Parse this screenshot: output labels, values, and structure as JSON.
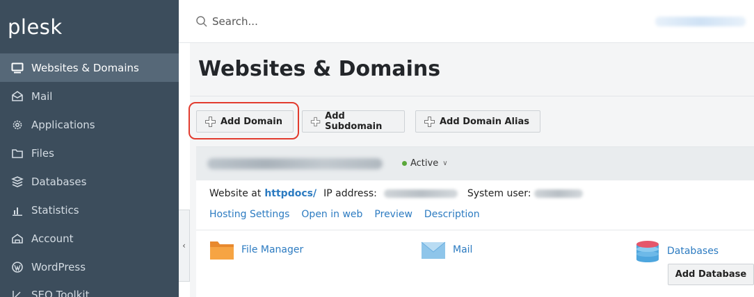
{
  "sidebar": {
    "logo": "plesk",
    "items": [
      {
        "label": "Websites & Domains",
        "icon": "monitor-icon",
        "active": true
      },
      {
        "label": "Mail",
        "icon": "mail-icon",
        "active": false
      },
      {
        "label": "Applications",
        "icon": "gear-icon",
        "active": false
      },
      {
        "label": "Files",
        "icon": "folder-icon",
        "active": false
      },
      {
        "label": "Databases",
        "icon": "database-icon",
        "active": false
      },
      {
        "label": "Statistics",
        "icon": "chart-icon",
        "active": false
      },
      {
        "label": "Account",
        "icon": "account-icon",
        "active": false
      },
      {
        "label": "WordPress",
        "icon": "wordpress-icon",
        "active": false
      },
      {
        "label": "SEO Toolkit",
        "icon": "seo-icon",
        "active": false
      }
    ],
    "collapse_glyph": "‹"
  },
  "topbar": {
    "search_placeholder": "Search..."
  },
  "main": {
    "title": "Websites & Domains",
    "buttons": {
      "add_domain": "Add Domain",
      "add_subdomain": "Add Subdomain",
      "add_domain_alias": "Add Domain Alias"
    },
    "domain": {
      "status": "Active",
      "website_at": "Website at",
      "docroot_link": "httpdocs/",
      "ip_label": "IP address:",
      "system_user_label": "System user:",
      "links": [
        "Hosting Settings",
        "Open in web",
        "Preview",
        "Description"
      ],
      "tools": {
        "file_manager": "File Manager",
        "mail": "Mail",
        "databases": "Databases",
        "add_database": "Add Database"
      }
    }
  },
  "colors": {
    "sidebar_bg": "#3c4d5c",
    "sidebar_active": "#566878",
    "link": "#2c7bc1",
    "highlight": "#e23b2e",
    "status_active": "#5aa83a"
  }
}
